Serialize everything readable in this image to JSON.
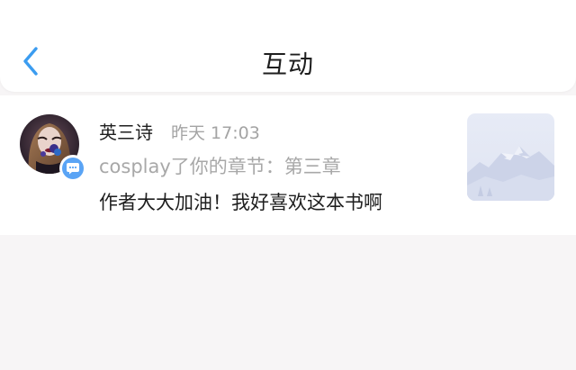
{
  "header": {
    "title": "互动",
    "back_icon": "chevron-left-icon",
    "back_color": "#3b9cf0"
  },
  "notification": {
    "username": "英三诗",
    "time": "昨天 17:03",
    "action": "cosplay了你的章节：第三章",
    "message": "作者大大加油！我好喜欢这本书啊",
    "badge_icon": "chat-bubble-icon",
    "badge_color": "#5aa4f5",
    "thumbnail_icon": "mountain-landscape-icon"
  }
}
